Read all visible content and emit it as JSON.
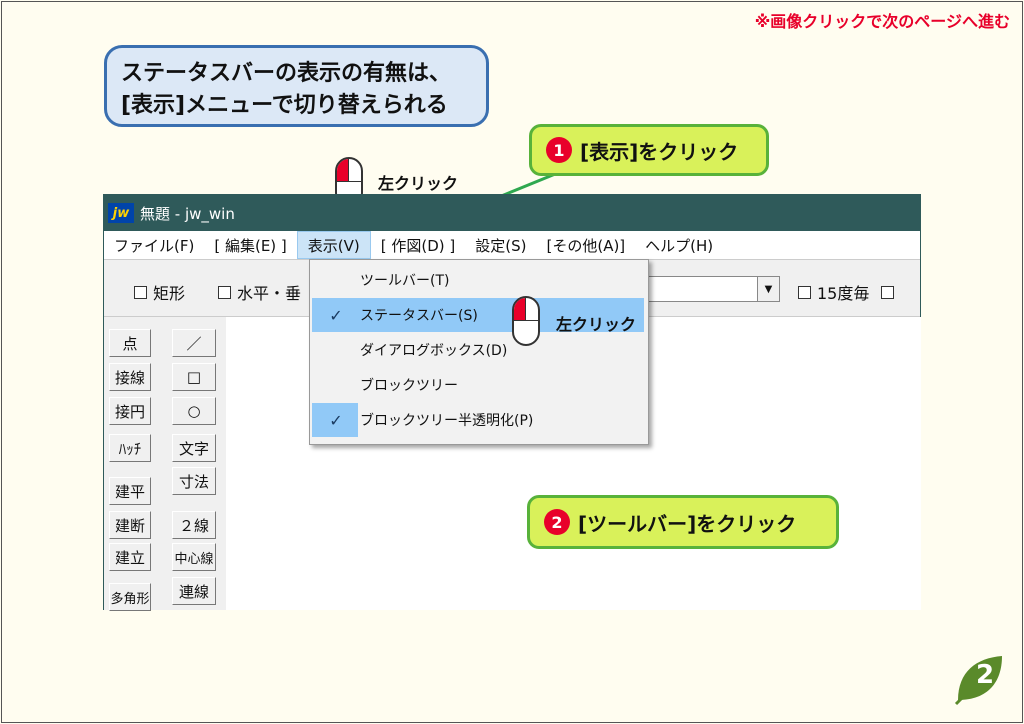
{
  "page": {
    "top_note": "※画像クリックで次のページへ進む",
    "explanation": [
      "ステータスバーの表示の有無は、",
      "[表示]メニューで切り替えられる"
    ],
    "callout1": {
      "num": "1",
      "text": "[表示]をクリック"
    },
    "callout2": {
      "num": "2",
      "text": "[ツールバー]をクリック"
    },
    "click_label_1": "左クリック",
    "click_label_2": "左クリック",
    "page_number": "2",
    "colors": {
      "accent_red": "#e8002a",
      "callout_green": "#d9f15a",
      "bubble_blue": "#dce8f6",
      "title_bar": "#2f5a5a"
    }
  },
  "window": {
    "logo": "jw",
    "title": "無題 - jw_win",
    "menu": [
      "ファイル(F)",
      "[ 編集(E) ]",
      "表示(V)",
      "[ 作図(D) ]",
      "設定(S)",
      "[その他(A)]",
      "ヘルプ(H)"
    ],
    "toolbar": {
      "rect": "矩形",
      "horiz": "水平・垂",
      "deg15": "15度毎"
    },
    "view_menu": [
      {
        "label": "ツールバー(T)",
        "checked": false,
        "highlighted": false
      },
      {
        "label": "ステータスバー(S)",
        "checked": true,
        "highlighted": true
      },
      {
        "label": "ダイアログボックス(D)",
        "checked": false,
        "highlighted": false
      },
      {
        "label": "ブロックツリー",
        "checked": false,
        "highlighted": false
      },
      {
        "label": "ブロックツリー半透明化(P)",
        "checked": true,
        "highlighted": false
      }
    ],
    "tools_left": [
      "点",
      "接線",
      "接円",
      "ﾊｯﾁ",
      "建平",
      "建断",
      "建立",
      "多角形"
    ],
    "tools_right": [
      "／",
      "□",
      "○",
      "文字",
      "寸法",
      "２線",
      "中心線",
      "連線"
    ]
  }
}
